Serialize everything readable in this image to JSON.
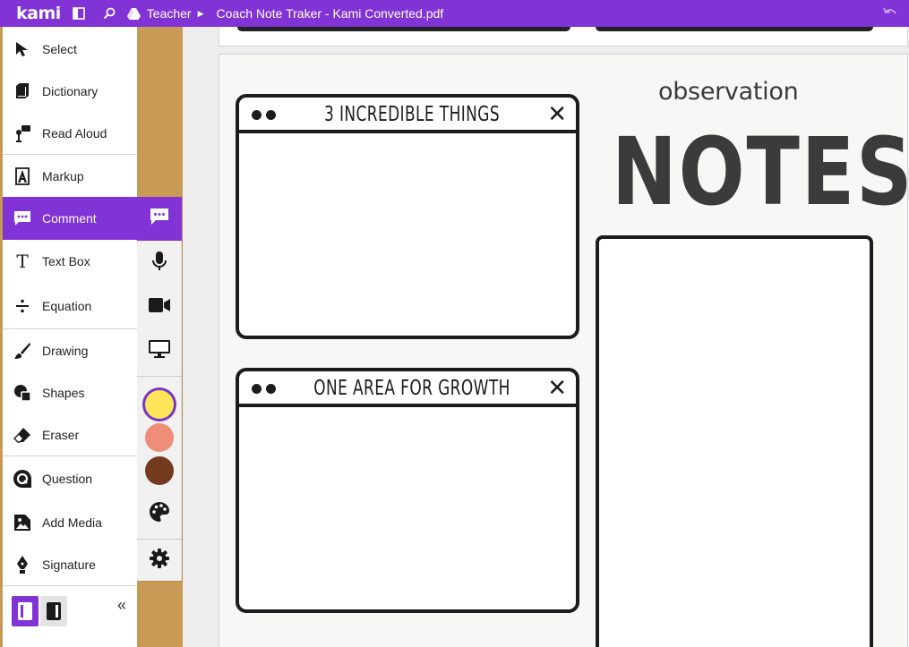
{
  "topbar": {
    "logo": "kami",
    "breadcrumb": "Teacher",
    "breadcrumb_sep": "▶",
    "document_title": "Coach Note Traker  - Kami Converted.pdf"
  },
  "tools": [
    {
      "label": "Select",
      "icon": "cursor-icon"
    },
    {
      "label": "Dictionary",
      "icon": "book-icon"
    },
    {
      "label": "Read Aloud",
      "icon": "read-aloud-icon"
    },
    {
      "label": "Markup",
      "icon": "markup-icon"
    },
    {
      "label": "Comment",
      "icon": "comment-icon",
      "active": true
    },
    {
      "label": "Text Box",
      "icon": "text-icon"
    },
    {
      "label": "Equation",
      "icon": "divide-icon"
    },
    {
      "label": "Drawing",
      "icon": "brush-icon"
    },
    {
      "label": "Shapes",
      "icon": "shapes-icon"
    },
    {
      "label": "Eraser",
      "icon": "eraser-icon"
    },
    {
      "label": "Question",
      "icon": "question-icon"
    },
    {
      "label": "Add Media",
      "icon": "image-icon"
    },
    {
      "label": "Signature",
      "icon": "pen-nib-icon"
    }
  ],
  "collapse_label": "«",
  "comment_subtools": [
    "comment-icon",
    "microphone-icon",
    "video-icon",
    "monitor-icon"
  ],
  "colors": {
    "accent": "#8133d6",
    "swatches": [
      "#fde55a",
      "#ee8d78",
      "#743a1f"
    ],
    "selected_swatch": "#fde55a"
  },
  "document": {
    "panel1_title": "3 INCREDIBLE THINGS",
    "panel2_title": "ONE AREA FOR GROWTH",
    "close_glyph": "✕",
    "heading_small": "observation",
    "heading_large": "NOTES"
  }
}
